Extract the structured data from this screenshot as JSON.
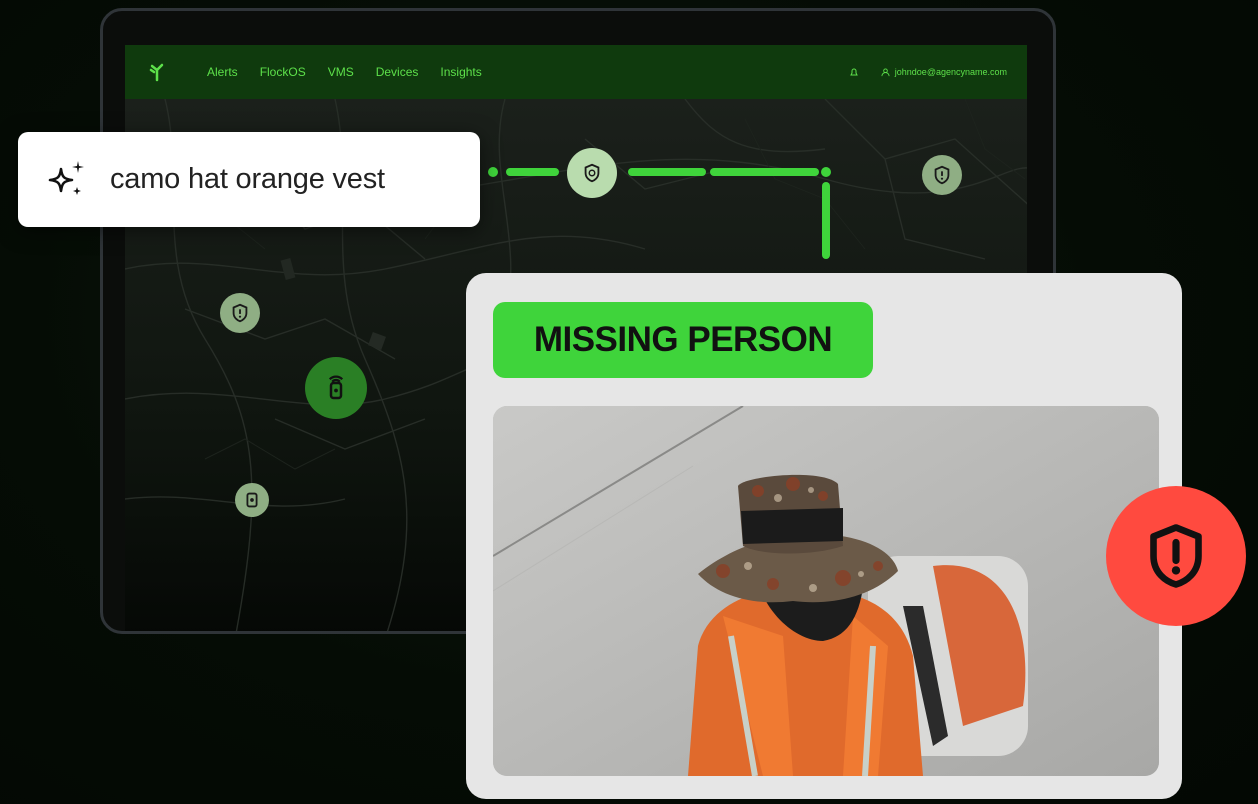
{
  "navbar": {
    "items": [
      {
        "label": "Alerts"
      },
      {
        "label": "FlockOS"
      },
      {
        "label": "VMS"
      },
      {
        "label": "Devices"
      },
      {
        "label": "Insights"
      }
    ],
    "account": "johndoe@agencyname.com"
  },
  "search": {
    "query": "camo hat orange vest"
  },
  "alert": {
    "title": "MISSING PERSON"
  },
  "colors": {
    "accent_green": "#3fd43b",
    "alert_red": "#ff4a3f",
    "nav_bg": "#0f3a0d"
  },
  "icons": {
    "brand": "flock-logo-icon",
    "search": "sparkle-icon",
    "node": "shield-icon",
    "alert": "shield-alert-icon"
  }
}
